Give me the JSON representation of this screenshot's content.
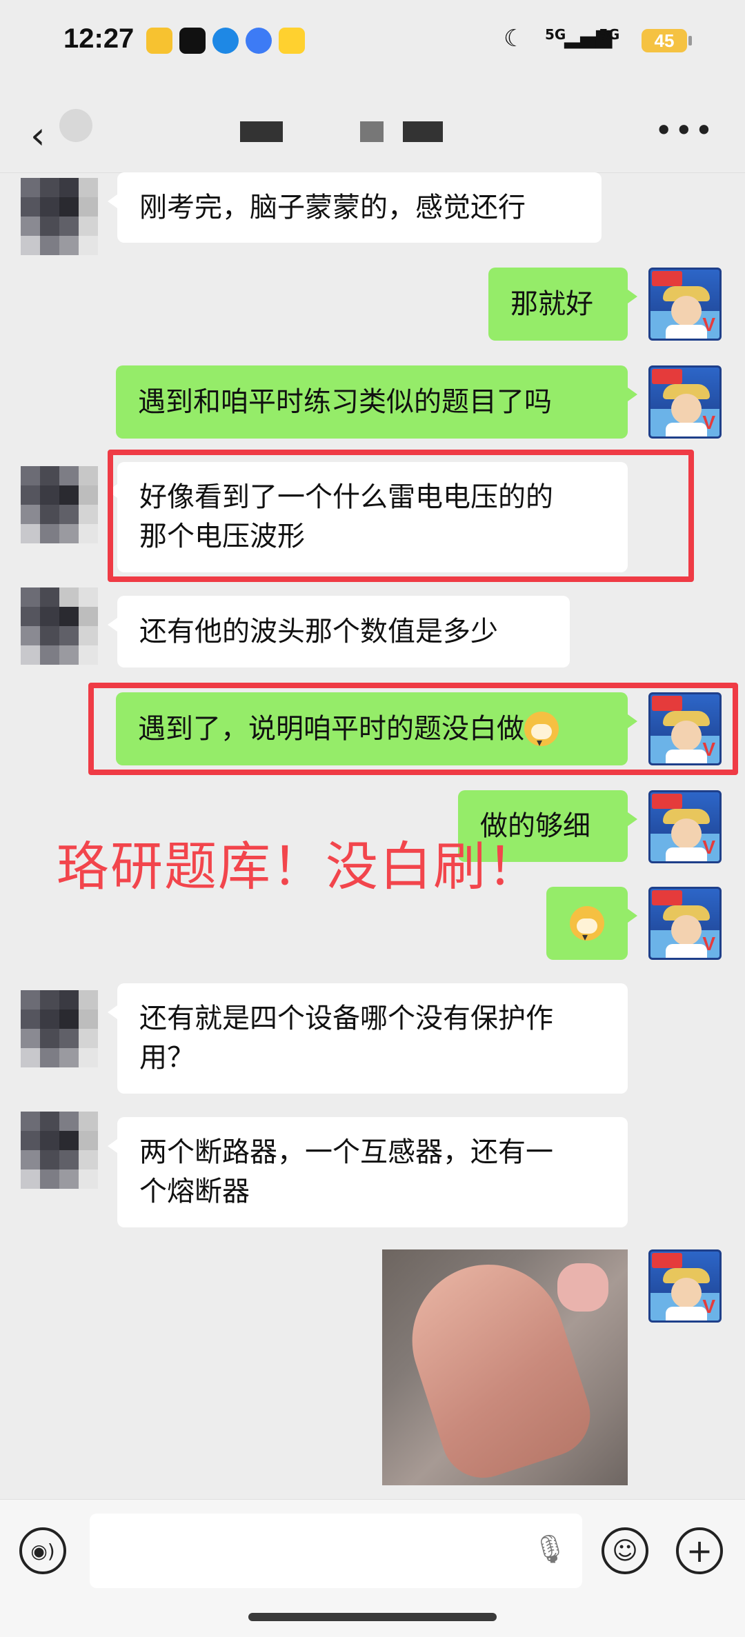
{
  "status_bar": {
    "time": "12:27",
    "signal_1": "5G",
    "signal_2": "5G",
    "battery": "45",
    "app_icons": [
      "#f7c230",
      "#111111",
      "#1e88e5",
      "#3d7bf5",
      "#ffd12f"
    ]
  },
  "nav": {
    "back_icon": "chevron-left",
    "more_icon": "ellipsis"
  },
  "messages": [
    {
      "side": "left",
      "text": "刚考完，脑子蒙蒙的，感觉还行"
    },
    {
      "side": "right",
      "text": "那就好"
    },
    {
      "side": "right",
      "text": "遇到和咱平时练习类似的题目了吗"
    },
    {
      "side": "left",
      "text": "好像看到了一个什么雷电电压的的\n那个电压波形"
    },
    {
      "side": "left",
      "text": "还有他的波头那个数值是多少"
    },
    {
      "side": "right",
      "text": "遇到了，说明咱平时的题没白做"
    },
    {
      "side": "right",
      "text": "做的够细"
    },
    {
      "side": "right",
      "text": "",
      "emoji": "doge"
    },
    {
      "side": "left",
      "text": "还有就是四个设备哪个没有保护作\n用？"
    },
    {
      "side": "left",
      "text": "两个断路器，一个互感器，还有一\n个熔断器"
    },
    {
      "side": "right",
      "image": "thumbs-up photo"
    }
  ],
  "overlay": {
    "text": "珞研题库！没白刷！",
    "color": "#f2454c"
  },
  "input_bar": {
    "voice_icon": "voice-icon",
    "mic_icon": "mic-icon",
    "emoji_icon": "emoji-icon",
    "plus_icon": "plus-icon"
  },
  "colors": {
    "background": "#ededed",
    "my_bubble": "#95ec69",
    "their_bubble": "#ffffff",
    "highlight": "#ef3b45"
  }
}
